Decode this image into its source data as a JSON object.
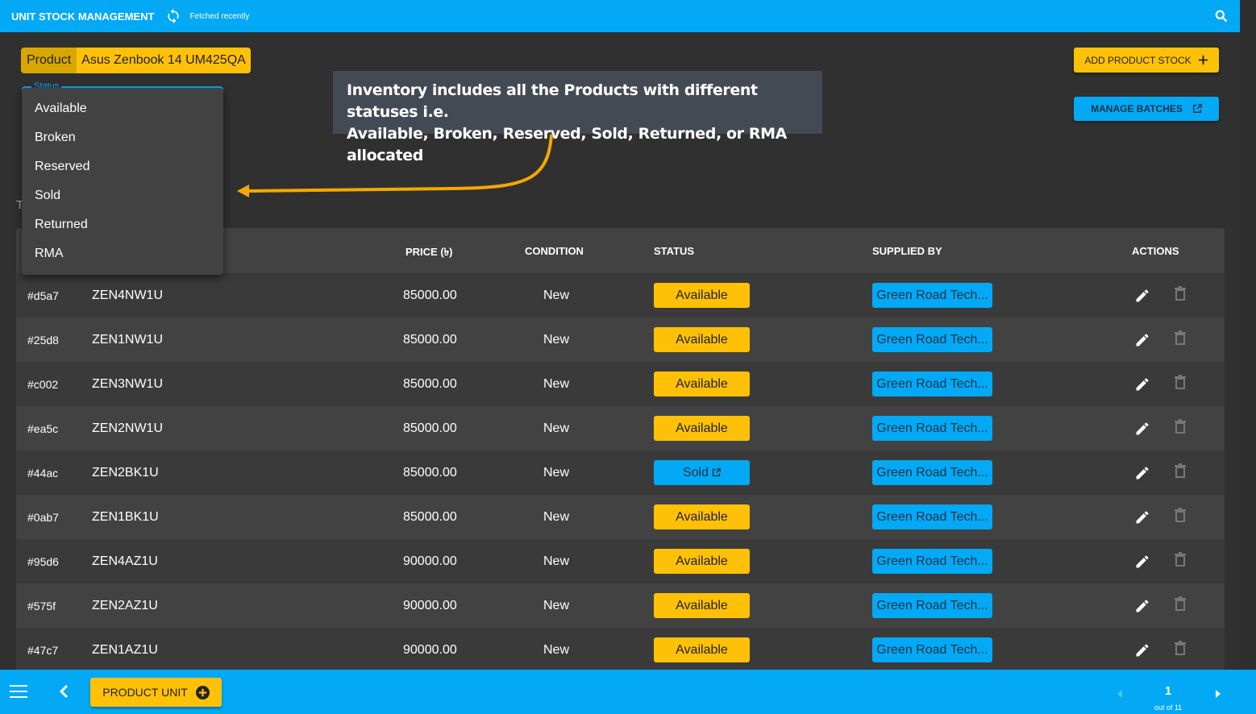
{
  "header": {
    "title": "UNIT STOCK MANAGEMENT",
    "fetch_status": "Fetched recently",
    "icons": {
      "sync": "sync-icon",
      "search": "search-icon"
    }
  },
  "product_filter": {
    "label": "Product",
    "value": "Asus Zenbook 14 UM425QA"
  },
  "actions": {
    "add_product_stock": "ADD PRODUCT STOCK",
    "manage_batches": "MANAGE BATCHES"
  },
  "status_filter": {
    "label": "Status",
    "options": [
      "Available",
      "Broken",
      "Reserved",
      "Sold",
      "Returned",
      "RMA"
    ]
  },
  "partial_label": "T",
  "callout": {
    "line1": "Inventory includes all the Products with different statuses i.e.",
    "line2": "Available, Broken, Reserved, Sold, Returned, or RMA allocated"
  },
  "table": {
    "columns": {
      "price": "PRICE (৳)",
      "condition": "CONDITION",
      "status": "STATUS",
      "supplied_by": "SUPPLIED BY",
      "actions": "ACTIONS"
    },
    "rows": [
      {
        "id": "#d5a7",
        "serial": "ZEN4NW1U",
        "price": "85000.00",
        "condition": "New",
        "status": "Available",
        "supplier": "Green Road Tech..."
      },
      {
        "id": "#25d8",
        "serial": "ZEN1NW1U",
        "price": "85000.00",
        "condition": "New",
        "status": "Available",
        "supplier": "Green Road Tech..."
      },
      {
        "id": "#c002",
        "serial": "ZEN3NW1U",
        "price": "85000.00",
        "condition": "New",
        "status": "Available",
        "supplier": "Green Road Tech..."
      },
      {
        "id": "#ea5c",
        "serial": "ZEN2NW1U",
        "price": "85000.00",
        "condition": "New",
        "status": "Available",
        "supplier": "Green Road Tech..."
      },
      {
        "id": "#44ac",
        "serial": "ZEN2BK1U",
        "price": "85000.00",
        "condition": "New",
        "status": "Sold",
        "supplier": "Green Road Tech..."
      },
      {
        "id": "#0ab7",
        "serial": "ZEN1BK1U",
        "price": "85000.00",
        "condition": "New",
        "status": "Available",
        "supplier": "Green Road Tech..."
      },
      {
        "id": "#95d6",
        "serial": "ZEN4AZ1U",
        "price": "90000.00",
        "condition": "New",
        "status": "Available",
        "supplier": "Green Road Tech..."
      },
      {
        "id": "#575f",
        "serial": "ZEN2AZ1U",
        "price": "90000.00",
        "condition": "New",
        "status": "Available",
        "supplier": "Green Road Tech..."
      },
      {
        "id": "#47c7",
        "serial": "ZEN1AZ1U",
        "price": "90000.00",
        "condition": "New",
        "status": "Available",
        "supplier": "Green Road Tech..."
      }
    ]
  },
  "footer": {
    "product_unit_button": "PRODUCT UNIT",
    "page": "1",
    "page_of": "out of 11"
  },
  "colors": {
    "primary": "#03a9f4",
    "accent": "#ffc107",
    "background": "#303030",
    "callout": "#434a54"
  }
}
